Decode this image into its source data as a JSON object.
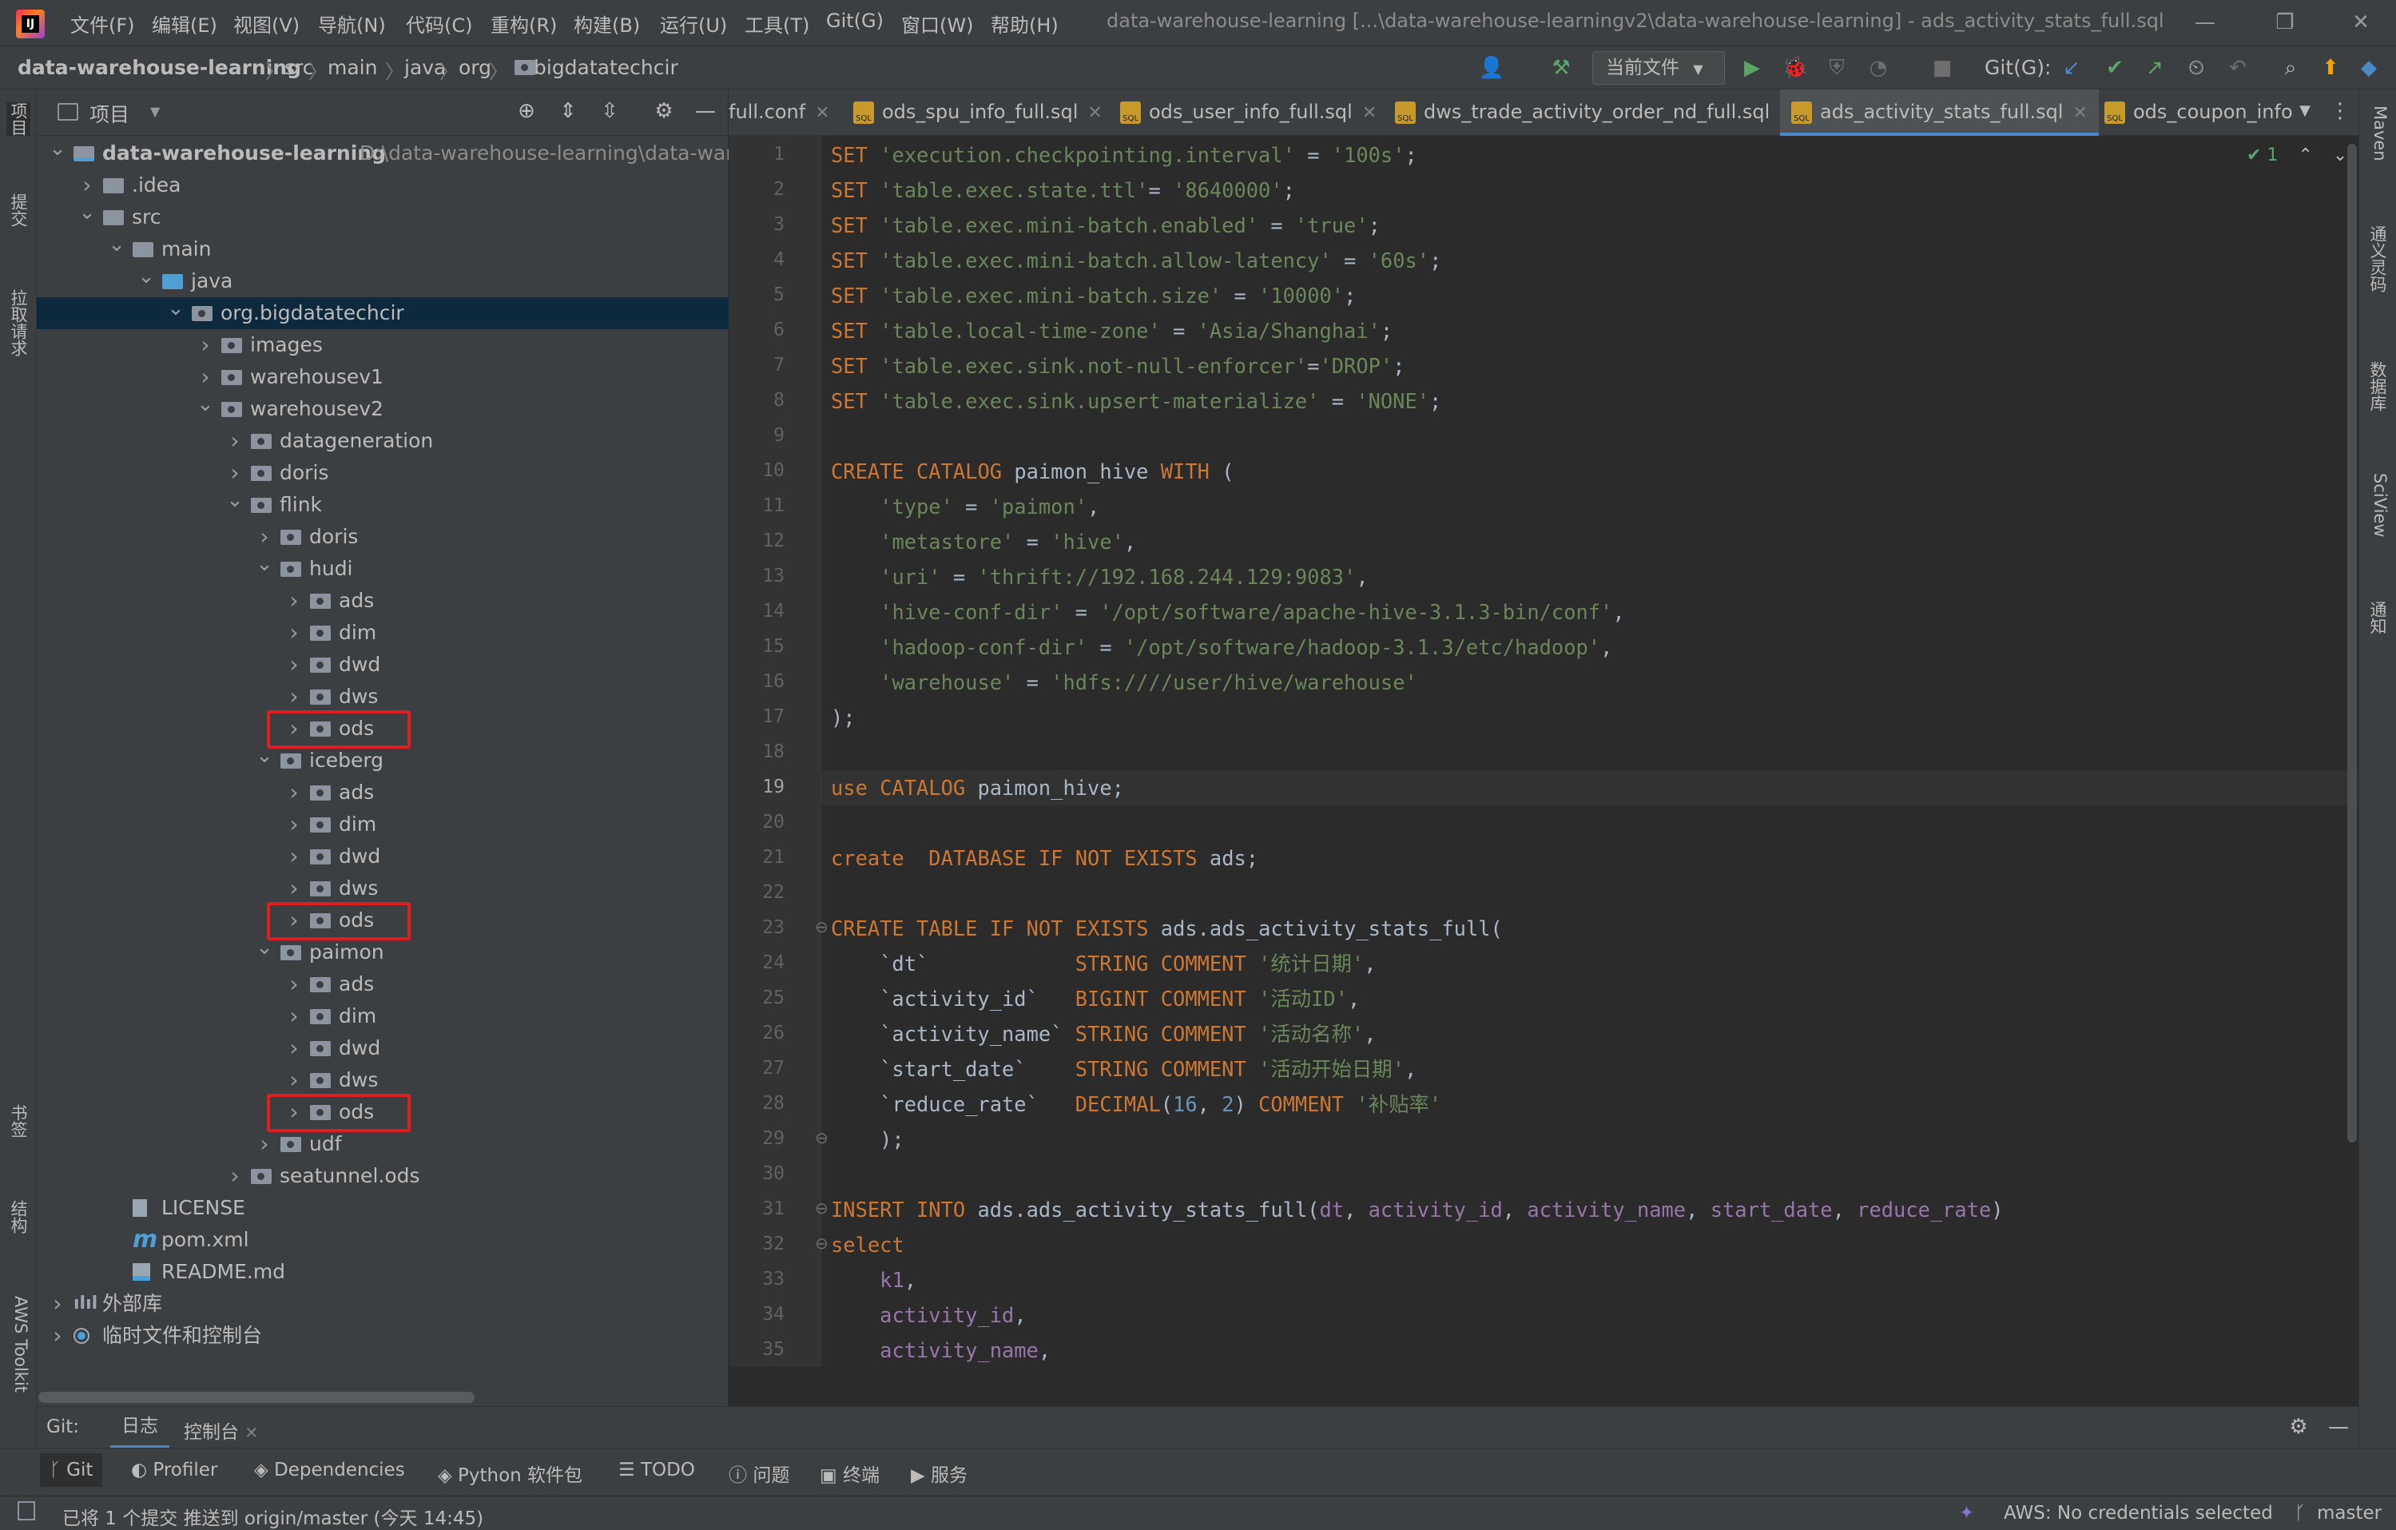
{
  "titlebar": {
    "menus": [
      "文件(F)",
      "编辑(E)",
      "视图(V)",
      "导航(N)",
      "代码(C)",
      "重构(R)",
      "构建(B)",
      "运行(U)",
      "工具(T)",
      "Git(G)",
      "窗口(W)",
      "帮助(H)"
    ],
    "window_title": "data-warehouse-learning [...\\data-warehouse-learningv2\\data-warehouse-learning] - ads_activity_stats_full.sql"
  },
  "navbar": {
    "breadcrumbs": [
      "data-warehouse-learning",
      "src",
      "main",
      "java",
      "org",
      "bigdatatechcir"
    ],
    "run_config": "当前文件",
    "git_label": "Git(G):"
  },
  "left_strip": {
    "tabs": [
      "项目",
      "提交",
      "拉取请求",
      "书签",
      "结构",
      "AWS Toolkit"
    ]
  },
  "right_strip": {
    "tabs": [
      "Maven",
      "通义灵码",
      "数据库",
      "SciView",
      "通知"
    ]
  },
  "project_panel": {
    "title": "项目",
    "tree": [
      {
        "label": "data-warehouse-learning",
        "path": "D:\\data-warehouse-learning\\data-wareh",
        "level": 0,
        "expanded": true,
        "icon": "module"
      },
      {
        "label": ".idea",
        "level": 1,
        "expanded": false,
        "icon": "folder"
      },
      {
        "label": "src",
        "level": 1,
        "expanded": true,
        "icon": "folder"
      },
      {
        "label": "main",
        "level": 2,
        "expanded": true,
        "icon": "folder"
      },
      {
        "label": "java",
        "level": 3,
        "expanded": true,
        "icon": "source"
      },
      {
        "label": "org.bigdatatechcir",
        "level": 4,
        "expanded": true,
        "icon": "package",
        "selected": true
      },
      {
        "label": "images",
        "level": 5,
        "expanded": false,
        "icon": "package"
      },
      {
        "label": "warehousev1",
        "level": 5,
        "expanded": false,
        "icon": "package"
      },
      {
        "label": "warehousev2",
        "level": 5,
        "expanded": true,
        "icon": "package"
      },
      {
        "label": "datageneration",
        "level": 6,
        "expanded": false,
        "icon": "package"
      },
      {
        "label": "doris",
        "level": 6,
        "expanded": false,
        "icon": "package"
      },
      {
        "label": "flink",
        "level": 6,
        "expanded": true,
        "icon": "package"
      },
      {
        "label": "doris",
        "level": 7,
        "expanded": false,
        "icon": "package"
      },
      {
        "label": "hudi",
        "level": 7,
        "expanded": true,
        "icon": "package"
      },
      {
        "label": "ads",
        "level": 8,
        "expanded": false,
        "icon": "package"
      },
      {
        "label": "dim",
        "level": 8,
        "expanded": false,
        "icon": "package"
      },
      {
        "label": "dwd",
        "level": 8,
        "expanded": false,
        "icon": "package"
      },
      {
        "label": "dws",
        "level": 8,
        "expanded": false,
        "icon": "package"
      },
      {
        "label": "ods",
        "level": 8,
        "expanded": false,
        "icon": "package",
        "highlight": true
      },
      {
        "label": "iceberg",
        "level": 7,
        "expanded": true,
        "icon": "package"
      },
      {
        "label": "ads",
        "level": 8,
        "expanded": false,
        "icon": "package"
      },
      {
        "label": "dim",
        "level": 8,
        "expanded": false,
        "icon": "package"
      },
      {
        "label": "dwd",
        "level": 8,
        "expanded": false,
        "icon": "package"
      },
      {
        "label": "dws",
        "level": 8,
        "expanded": false,
        "icon": "package"
      },
      {
        "label": "ods",
        "level": 8,
        "expanded": false,
        "icon": "package",
        "highlight": true
      },
      {
        "label": "paimon",
        "level": 7,
        "expanded": true,
        "icon": "package"
      },
      {
        "label": "ads",
        "level": 8,
        "expanded": false,
        "icon": "package"
      },
      {
        "label": "dim",
        "level": 8,
        "expanded": false,
        "icon": "package"
      },
      {
        "label": "dwd",
        "level": 8,
        "expanded": false,
        "icon": "package"
      },
      {
        "label": "dws",
        "level": 8,
        "expanded": false,
        "icon": "package"
      },
      {
        "label": "ods",
        "level": 8,
        "expanded": false,
        "icon": "package",
        "highlight": true
      },
      {
        "label": "udf",
        "level": 7,
        "expanded": false,
        "icon": "package"
      },
      {
        "label": "seatunnel.ods",
        "level": 6,
        "expanded": false,
        "icon": "package"
      },
      {
        "label": "LICENSE",
        "level": 2,
        "icon": "file"
      },
      {
        "label": "pom.xml",
        "level": 2,
        "icon": "maven"
      },
      {
        "label": "README.md",
        "level": 2,
        "icon": "md"
      },
      {
        "label": "外部库",
        "level": 0,
        "expanded": false,
        "icon": "library"
      },
      {
        "label": "临时文件和控制台",
        "level": 0,
        "expanded": false,
        "icon": "scratch"
      }
    ]
  },
  "editor_tabs": [
    {
      "label": "full.conf",
      "active": false
    },
    {
      "label": "ods_spu_info_full.sql",
      "active": false
    },
    {
      "label": "ods_user_info_full.sql",
      "active": false
    },
    {
      "label": "dws_trade_activity_order_nd_full.sql",
      "active": false
    },
    {
      "label": "ads_activity_stats_full.sql",
      "active": true
    },
    {
      "label": "ods_coupon_info",
      "active": false
    }
  ],
  "inspection_count": "1",
  "editor": {
    "current_line": 19,
    "lines": [
      {
        "n": "1",
        "t": "SET 'execution.checkpointing.interval' = '100s';"
      },
      {
        "n": "2",
        "t": "SET 'table.exec.state.ttl'= '8640000';"
      },
      {
        "n": "3",
        "t": "SET 'table.exec.mini-batch.enabled' = 'true';"
      },
      {
        "n": "4",
        "t": "SET 'table.exec.mini-batch.allow-latency' = '60s';"
      },
      {
        "n": "5",
        "t": "SET 'table.exec.mini-batch.size' = '10000';"
      },
      {
        "n": "6",
        "t": "SET 'table.local-time-zone' = 'Asia/Shanghai';"
      },
      {
        "n": "7",
        "t": "SET 'table.exec.sink.not-null-enforcer'='DROP';"
      },
      {
        "n": "8",
        "t": "SET 'table.exec.sink.upsert-materialize' = 'NONE';"
      },
      {
        "n": "9",
        "t": ""
      },
      {
        "n": "10",
        "t": "CREATE CATALOG paimon_hive WITH ("
      },
      {
        "n": "11",
        "t": "    'type' = 'paimon',"
      },
      {
        "n": "12",
        "t": "    'metastore' = 'hive',"
      },
      {
        "n": "13",
        "t": "    'uri' = 'thrift://192.168.244.129:9083',"
      },
      {
        "n": "14",
        "t": "    'hive-conf-dir' = '/opt/software/apache-hive-3.1.3-bin/conf',"
      },
      {
        "n": "15",
        "t": "    'hadoop-conf-dir' = '/opt/software/hadoop-3.1.3/etc/hadoop',"
      },
      {
        "n": "16",
        "t": "    'warehouse' = 'hdfs:////user/hive/warehouse'"
      },
      {
        "n": "17",
        "t": ");"
      },
      {
        "n": "18",
        "t": ""
      },
      {
        "n": "19",
        "t": "use CATALOG paimon_hive;"
      },
      {
        "n": "20",
        "t": ""
      },
      {
        "n": "21",
        "t": "create  DATABASE IF NOT EXISTS ads;"
      },
      {
        "n": "22",
        "t": ""
      },
      {
        "n": "23",
        "t": "CREATE TABLE IF NOT EXISTS ads.ads_activity_stats_full("
      },
      {
        "n": "24",
        "t": "    `dt`            STRING COMMENT '统计日期',"
      },
      {
        "n": "25",
        "t": "    `activity_id`   BIGINT COMMENT '活动ID',"
      },
      {
        "n": "26",
        "t": "    `activity_name` STRING COMMENT '活动名称',"
      },
      {
        "n": "27",
        "t": "    `start_date`    STRING COMMENT '活动开始日期',"
      },
      {
        "n": "28",
        "t": "    `reduce_rate`   DECIMAL(16, 2) COMMENT '补贴率'"
      },
      {
        "n": "29",
        "t": "    );"
      },
      {
        "n": "30",
        "t": ""
      },
      {
        "n": "31",
        "t": "INSERT INTO ads.ads_activity_stats_full(dt, activity_id, activity_name, start_date, reduce_rate)"
      },
      {
        "n": "32",
        "t": "select"
      },
      {
        "n": "33",
        "t": "    k1,"
      },
      {
        "n": "34",
        "t": "    activity_id,"
      },
      {
        "n": "35",
        "t": "    activity_name,"
      }
    ]
  },
  "bottom_tabs": {
    "git": "Git:",
    "log": "日志",
    "console": "控制台"
  },
  "toolwindows": [
    "Git",
    "Profiler",
    "Dependencies",
    "Python 软件包",
    "TODO",
    "问题",
    "终端",
    "服务"
  ],
  "status": {
    "message": "已将 1 个提交 推送到 origin/master (今天 14:45)",
    "aws": "AWS: No credentials selected",
    "branch": "master"
  }
}
